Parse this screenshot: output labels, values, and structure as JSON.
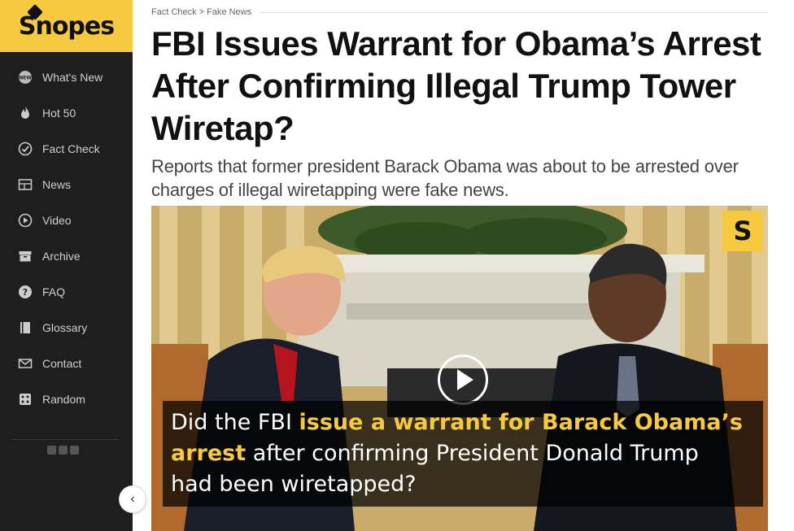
{
  "sidebar": {
    "logo": "Snopes",
    "items": [
      {
        "label": "What's New",
        "icon": "new-badge-icon"
      },
      {
        "label": "Hot 50",
        "icon": "flame-icon"
      },
      {
        "label": "Fact Check",
        "icon": "check-circle-icon"
      },
      {
        "label": "News",
        "icon": "newspaper-icon"
      },
      {
        "label": "Video",
        "icon": "play-circle-icon"
      },
      {
        "label": "Archive",
        "icon": "archive-box-icon"
      },
      {
        "label": "FAQ",
        "icon": "question-circle-icon"
      },
      {
        "label": "Glossary",
        "icon": "book-icon"
      },
      {
        "label": "Contact",
        "icon": "envelope-icon"
      },
      {
        "label": "Random",
        "icon": "dice-icon"
      }
    ],
    "collapse_icon": "chevron-left-icon"
  },
  "breadcrumb": {
    "section": "Fact Check",
    "separator": ">",
    "category": "Fake News"
  },
  "article": {
    "title": "FBI Issues Warrant for Obama’s Arrest After Confirming Illegal Trump Tower Wiretap?",
    "subtitle": "Reports that former president Barack Obama was about to be arrested over charges of illegal wiretapping were fake news."
  },
  "video": {
    "badge": "S",
    "caption": {
      "l1_a": "Did the FBI ",
      "l1_b": "issue a warrant for Barack Obama’s",
      "l2_a": "arrest",
      "l2_b": " after confirming President Donald Trump",
      "l3": "had been wiretapped?"
    }
  },
  "colors": {
    "brand_yellow": "#f6c93f",
    "sidebar_bg": "#1e1e1e"
  }
}
